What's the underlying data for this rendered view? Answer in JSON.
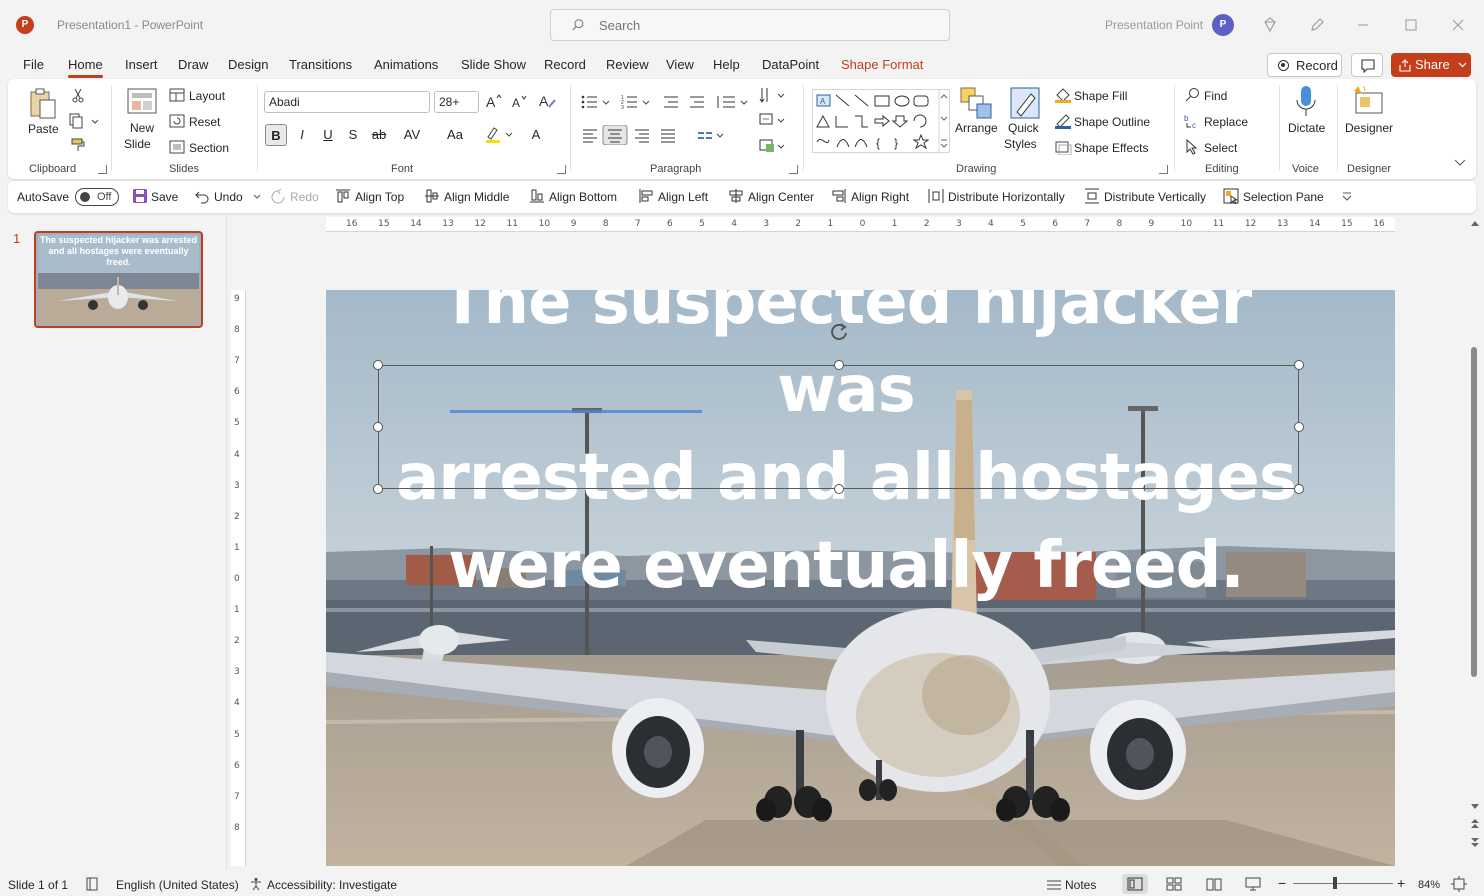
{
  "titlebar": {
    "app_logo": "P",
    "doc_title": "Presentation1  -  PowerPoint",
    "search_placeholder": "Search",
    "account_name": "Presentation Point",
    "avatar_initials": "P"
  },
  "tabs": [
    {
      "label": "File"
    },
    {
      "label": "Home"
    },
    {
      "label": "Insert"
    },
    {
      "label": "Draw"
    },
    {
      "label": "Design"
    },
    {
      "label": "Transitions"
    },
    {
      "label": "Animations"
    },
    {
      "label": "Slide Show"
    },
    {
      "label": "Record"
    },
    {
      "label": "Review"
    },
    {
      "label": "View"
    },
    {
      "label": "Help"
    },
    {
      "label": "DataPoint"
    },
    {
      "label": "Shape Format"
    }
  ],
  "header_actions": {
    "record": "Record",
    "share": "Share"
  },
  "ribbon": {
    "clipboard": {
      "paste": "Paste",
      "group": "Clipboard"
    },
    "slides": {
      "new_slide_1": "New",
      "new_slide_2": "Slide",
      "layout": "Layout",
      "reset": "Reset",
      "section": "Section",
      "group": "Slides"
    },
    "font": {
      "family": "Abadi",
      "size": "28+",
      "group": "Font",
      "bold": "B",
      "italic": "I",
      "underline": "U",
      "shadow": "S",
      "strike": "ab",
      "spacing": "AV",
      "case": "Aa",
      "color": "A"
    },
    "paragraph": {
      "group": "Paragraph"
    },
    "drawing": {
      "arrange": "Arrange",
      "quick_1": "Quick",
      "quick_2": "Styles",
      "shape_fill": "Shape Fill",
      "shape_outline": "Shape Outline",
      "shape_effects": "Shape Effects",
      "group": "Drawing"
    },
    "editing": {
      "find": "Find",
      "replace": "Replace",
      "select": "Select",
      "group": "Editing"
    },
    "voice": {
      "dictate": "Dictate",
      "group": "Voice"
    },
    "designer": {
      "designer": "Designer",
      "group": "Designer"
    }
  },
  "qat": {
    "autosave": "AutoSave",
    "autosave_state": "Off",
    "save": "Save",
    "undo": "Undo",
    "redo": "Redo",
    "align_top": "Align Top",
    "align_middle": "Align Middle",
    "align_bottom": "Align Bottom",
    "align_left": "Align Left",
    "align_center": "Align Center",
    "align_right": "Align Right",
    "distribute_h": "Distribute Horizontally",
    "distribute_v": "Distribute Vertically",
    "selection_pane": "Selection Pane"
  },
  "thumbnails": [
    {
      "number": "1",
      "text": "The suspected hijacker was arrested and all hostages were eventually freed."
    }
  ],
  "slide": {
    "text_line1": "The suspected hijacker was",
    "text_line2": "arrested and all hostages",
    "text_line3": "were eventually freed."
  },
  "hruler_ticks": [
    "16",
    "15",
    "14",
    "13",
    "12",
    "11",
    "10",
    "9",
    "8",
    "7",
    "6",
    "5",
    "4",
    "3",
    "2",
    "1",
    "0",
    "1",
    "2",
    "3",
    "4",
    "5",
    "6",
    "7",
    "8",
    "9",
    "10",
    "11",
    "12",
    "13",
    "14",
    "15",
    "16"
  ],
  "vruler_ticks": [
    "9",
    "8",
    "7",
    "6",
    "5",
    "4",
    "3",
    "2",
    "1",
    "0",
    "1",
    "2",
    "3",
    "4",
    "5",
    "6",
    "7",
    "8"
  ],
  "statusbar": {
    "slide_count": "Slide 1 of 1",
    "language": "English (United States)",
    "accessibility": "Accessibility: Investigate",
    "notes": "Notes",
    "zoom": "84%"
  },
  "colors": {
    "accent": "#c43e1c",
    "sky": "#a9bccb",
    "tarmac": "#b9ab98"
  }
}
